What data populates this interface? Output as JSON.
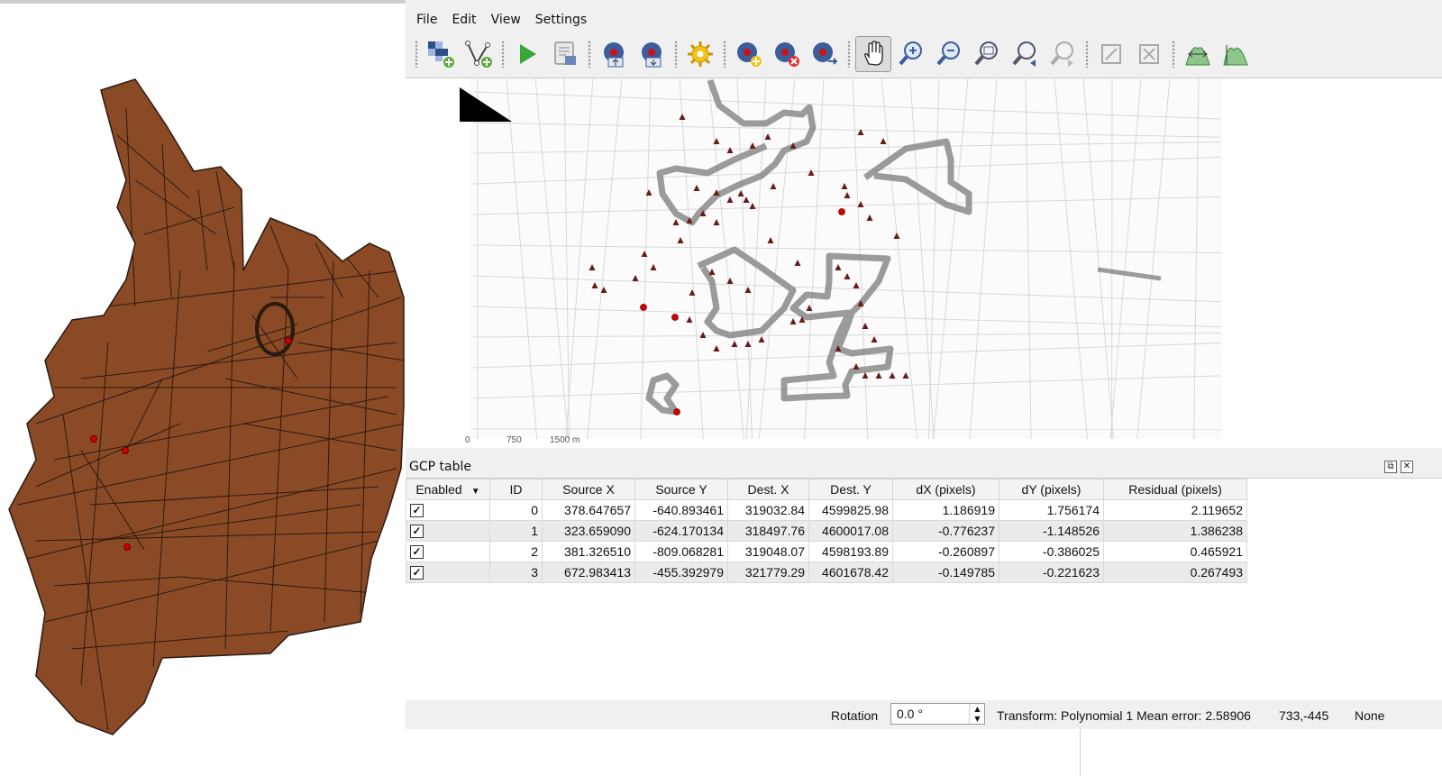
{
  "menubar": {
    "items": [
      {
        "label": "File",
        "name": "menu-file"
      },
      {
        "label": "Edit",
        "name": "menu-edit"
      },
      {
        "label": "View",
        "name": "menu-view"
      },
      {
        "label": "Settings",
        "name": "menu-settings"
      }
    ]
  },
  "toolbar": {
    "buttons": [
      {
        "icon": "add-raster-icon"
      },
      {
        "icon": "add-vector-icon"
      },
      {
        "icon": "start-georeferencing-icon"
      },
      {
        "icon": "generate-gdal-script-icon"
      },
      {
        "icon": "load-gcp-points-icon"
      },
      {
        "icon": "save-gcp-points-icon"
      },
      {
        "icon": "transformation-settings-icon"
      },
      {
        "icon": "add-point-icon"
      },
      {
        "icon": "delete-point-icon"
      },
      {
        "icon": "move-gcp-point-icon"
      },
      {
        "icon": "pan-icon"
      },
      {
        "icon": "zoom-in-icon"
      },
      {
        "icon": "zoom-out-icon"
      },
      {
        "icon": "zoom-to-layer-icon"
      },
      {
        "icon": "zoom-last-icon"
      },
      {
        "icon": "zoom-next-icon"
      },
      {
        "icon": "link-georeferencer-icon"
      },
      {
        "icon": "link-qgis-icon"
      },
      {
        "icon": "full-histogram-stretch-icon"
      },
      {
        "icon": "local-histogram-stretch-icon"
      }
    ]
  },
  "canvas": {
    "scale_bar": [
      "0",
      "750",
      "1500 m"
    ]
  },
  "gcp_panel": {
    "title": "GCP table",
    "columns": [
      "Enabled",
      "ID",
      "Source X",
      "Source Y",
      "Dest. X",
      "Dest. Y",
      "dX (pixels)",
      "dY (pixels)",
      "Residual (pixels)"
    ],
    "rows": [
      {
        "enabled": true,
        "id": "0",
        "source_x": "378.647657",
        "source_y": "-640.893461",
        "dest_x": "319032.84",
        "dest_y": "4599825.98",
        "dx": "1.186919",
        "dy": "1.756174",
        "residual": "2.119652"
      },
      {
        "enabled": true,
        "id": "1",
        "source_x": "323.659090",
        "source_y": "-624.170134",
        "dest_x": "318497.76",
        "dest_y": "4600017.08",
        "dx": "-0.776237",
        "dy": "-1.148526",
        "residual": "1.386238"
      },
      {
        "enabled": true,
        "id": "2",
        "source_x": "381.326510",
        "source_y": "-809.068281",
        "dest_x": "319048.07",
        "dest_y": "4598193.89",
        "dx": "-0.260897",
        "dy": "-0.386025",
        "residual": "0.465921"
      },
      {
        "enabled": true,
        "id": "3",
        "source_x": "672.983413",
        "source_y": "-455.392979",
        "dest_x": "321779.29",
        "dest_y": "4601678.42",
        "dx": "-0.149785",
        "dy": "-0.221623",
        "residual": "0.267493"
      }
    ]
  },
  "statusbar": {
    "rotation_label": "Rotation",
    "rotation_value": "0.0 °",
    "transform_text": "Transform: Polynomial 1 Mean error: 2.58906",
    "coords": "733,-445",
    "crs": "None"
  },
  "colors": {
    "parcel_fill": "#8b4a26",
    "parcel_stroke": "#2a1a10",
    "point_red": "#d40000"
  }
}
